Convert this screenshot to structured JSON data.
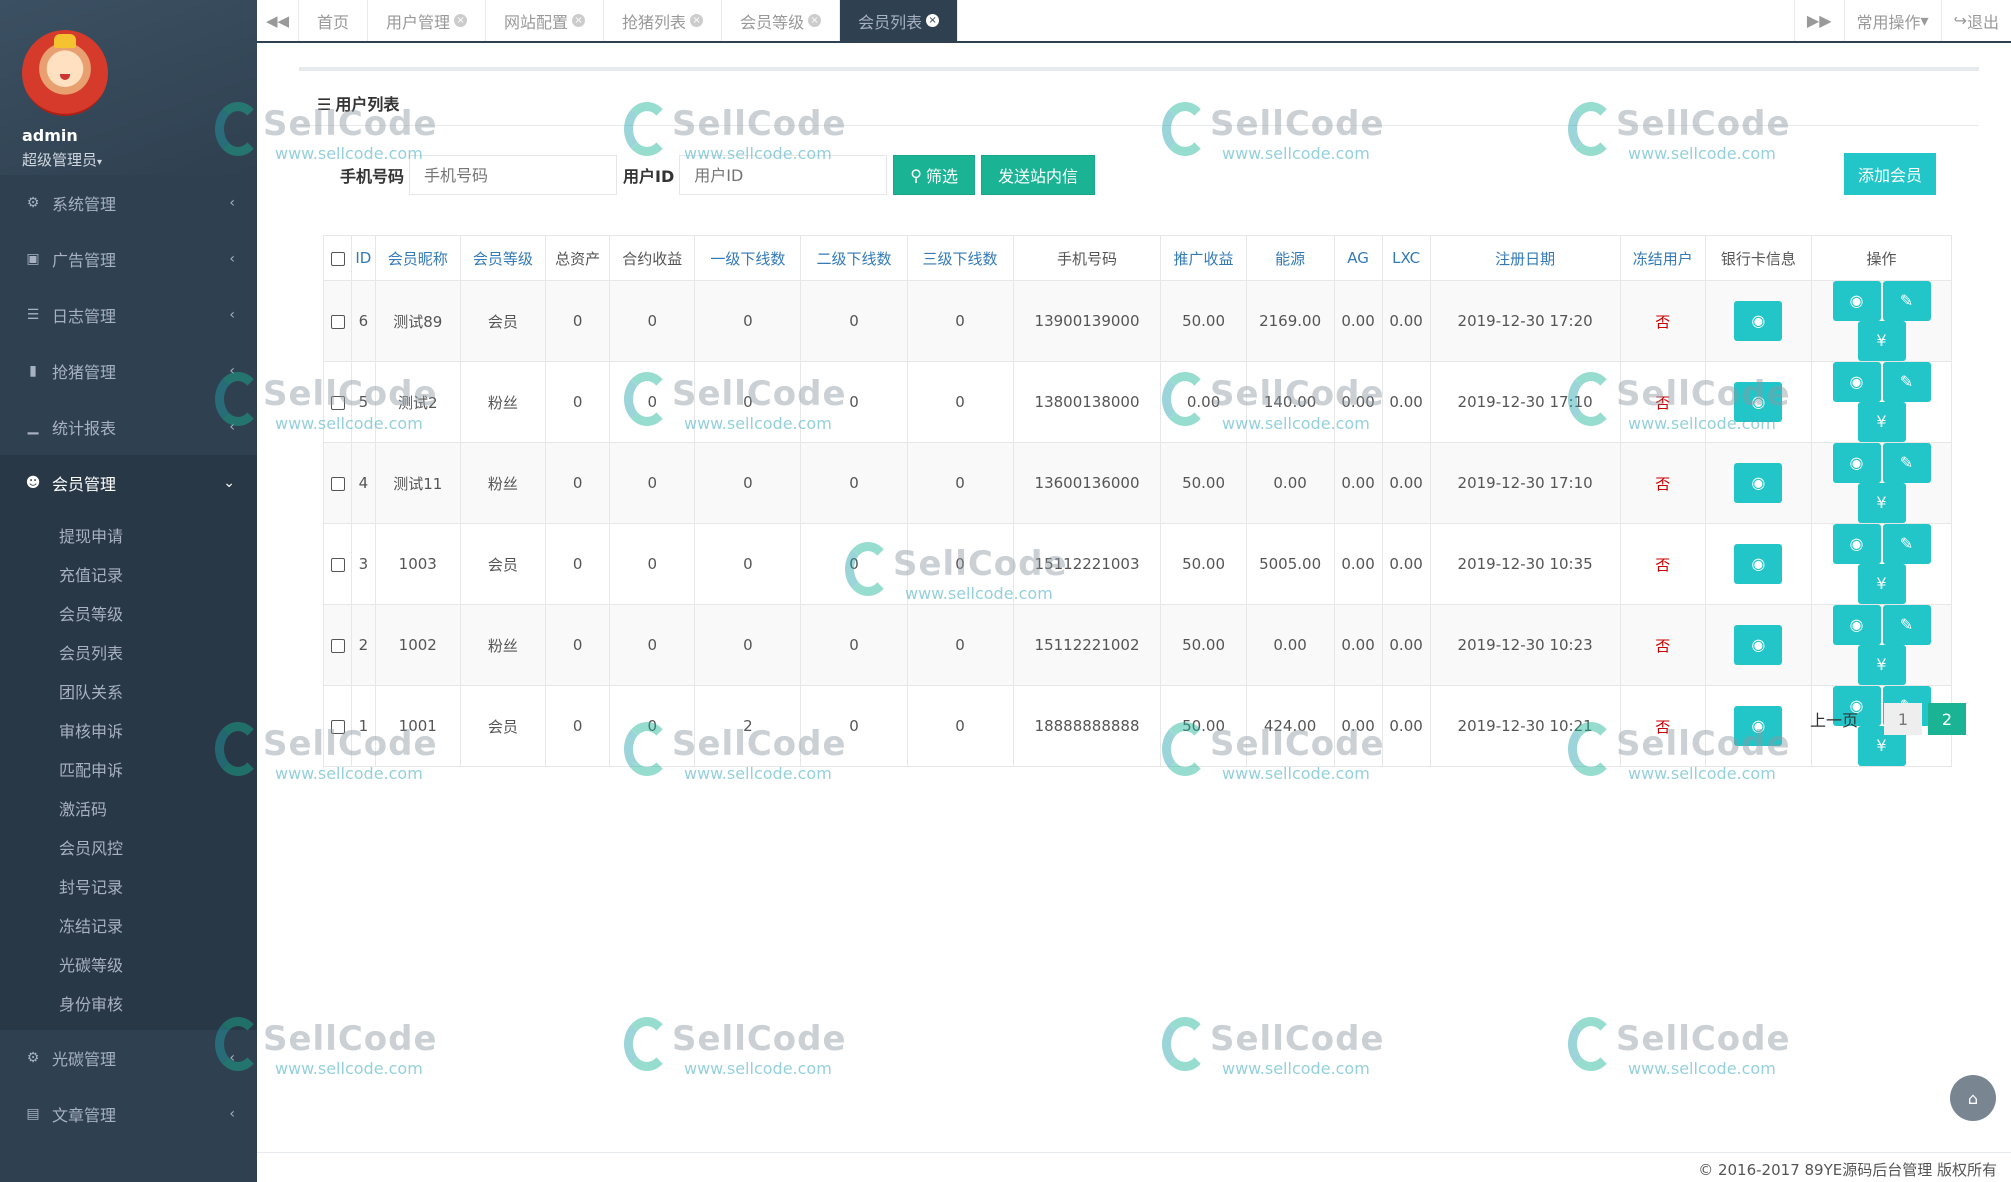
{
  "sidebar": {
    "user": {
      "name": "admin",
      "role": "超级管理员"
    },
    "menu_top": [
      {
        "label": "系统管理",
        "icon": "gear-icon"
      },
      {
        "label": "广告管理",
        "icon": "image-icon"
      },
      {
        "label": "日志管理",
        "icon": "list-icon"
      },
      {
        "label": "抢猪管理",
        "icon": "book-icon"
      },
      {
        "label": "统计报表",
        "icon": "signal-icon"
      }
    ],
    "active_menu": {
      "label": "会员管理",
      "icon": "user-icon"
    },
    "submenu": [
      "提现申请",
      "充值记录",
      "会员等级",
      "会员列表",
      "团队关系",
      "审核申诉",
      "匹配申诉",
      "激活码",
      "会员风控",
      "封号记录",
      "冻结记录",
      "光碳等级",
      "身份审核"
    ],
    "menu_bottom": [
      {
        "label": "光碳管理",
        "icon": "gear-icon"
      },
      {
        "label": "文章管理",
        "icon": "archive-icon"
      }
    ]
  },
  "topbar": {
    "tabs": [
      {
        "label": "首页",
        "closable": false
      },
      {
        "label": "用户管理",
        "closable": true
      },
      {
        "label": "网站配置",
        "closable": true
      },
      {
        "label": "抢猪列表",
        "closable": true
      },
      {
        "label": "会员等级",
        "closable": true
      },
      {
        "label": "会员列表",
        "closable": true,
        "active": true
      }
    ],
    "common_ops": "常用操作",
    "logout": "退出"
  },
  "panel": {
    "title": "用户列表",
    "filter": {
      "phone_label": "手机号码",
      "phone_placeholder": "手机号码",
      "uid_label": "用户ID",
      "uid_placeholder": "用户ID",
      "search_btn": "筛选",
      "message_btn": "发送站内信"
    },
    "add_btn": "添加会员"
  },
  "table": {
    "columns": [
      "ID",
      "会员昵称",
      "会员等级",
      "总资产",
      "合约收益",
      "一级下线数",
      "二级下线数",
      "三级下线数",
      "手机号码",
      "推广收益",
      "能源",
      "AG",
      "LXC",
      "注册日期",
      "冻结用户",
      "银行卡信息",
      "操作"
    ],
    "rows": [
      [
        "6",
        "测试89",
        "会员",
        "0",
        "0",
        "0",
        "0",
        "0",
        "13900139000",
        "50.00",
        "2169.00",
        "0.00",
        "0.00",
        "2019-12-30 17:20",
        "否"
      ],
      [
        "5",
        "测试2",
        "粉丝",
        "0",
        "0",
        "0",
        "0",
        "0",
        "13800138000",
        "0.00",
        "140.00",
        "0.00",
        "0.00",
        "2019-12-30 17:10",
        "否"
      ],
      [
        "4",
        "测试11",
        "粉丝",
        "0",
        "0",
        "0",
        "0",
        "0",
        "13600136000",
        "50.00",
        "0.00",
        "0.00",
        "0.00",
        "2019-12-30 17:10",
        "否"
      ],
      [
        "3",
        "1003",
        "会员",
        "0",
        "0",
        "0",
        "0",
        "0",
        "15112221003",
        "50.00",
        "5005.00",
        "0.00",
        "0.00",
        "2019-12-30 10:35",
        "否"
      ],
      [
        "2",
        "1002",
        "粉丝",
        "0",
        "0",
        "0",
        "0",
        "0",
        "15112221002",
        "50.00",
        "0.00",
        "0.00",
        "0.00",
        "2019-12-30 10:23",
        "否"
      ],
      [
        "1",
        "1001",
        "会员",
        "0",
        "0",
        "2",
        "0",
        "0",
        "18888888888",
        "50.00",
        "424.00",
        "0.00",
        "0.00",
        "2019-12-30 10:21",
        "否"
      ]
    ]
  },
  "pagination": {
    "prev": "上一页",
    "pages": [
      "1",
      "2"
    ],
    "current": "2"
  },
  "footer": "© 2016-2017 89YE源码后台管理 版权所有",
  "watermark": {
    "brand": "SellCode",
    "url": "www.sellcode.com"
  }
}
